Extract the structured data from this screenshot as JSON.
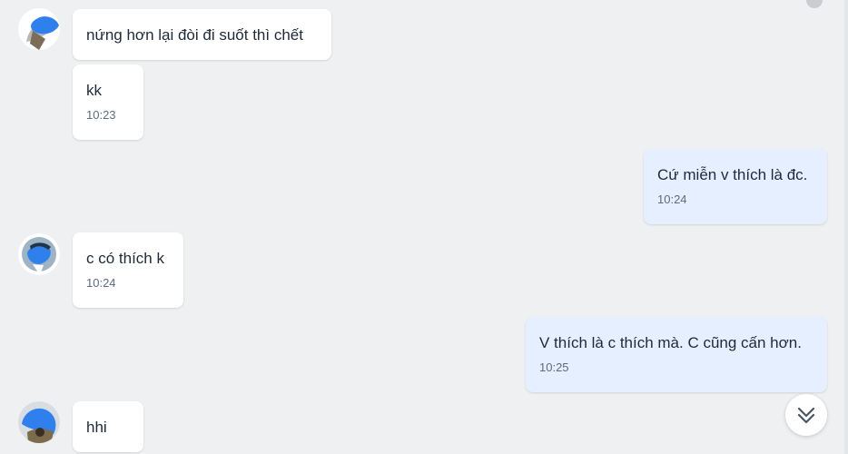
{
  "colors": {
    "background": "#eef0f2",
    "incoming_bubble": "#ffffff",
    "outgoing_bubble": "#e5efff",
    "time_text": "#5f6b7a",
    "accent_blue": "#2f80ed"
  },
  "messages": [
    {
      "sender": "other",
      "text": "nứng hơn lại đòi đi suốt thì chết",
      "time": ""
    },
    {
      "sender": "other",
      "text": "kk",
      "time": "10:23"
    },
    {
      "sender": "me",
      "text": "Cứ miễn v thích là đc.",
      "time": "10:24"
    },
    {
      "sender": "other",
      "text": "c có thích k",
      "time": "10:24"
    },
    {
      "sender": "me",
      "text": "V thích là c thích mà. C cũng cấn hơn.",
      "time": "10:25"
    },
    {
      "sender": "other",
      "text": "hhi",
      "time": ""
    }
  ],
  "icons": {
    "avatar": "contact-avatar-icon",
    "scroll_down": "double-chevron-down-icon"
  }
}
